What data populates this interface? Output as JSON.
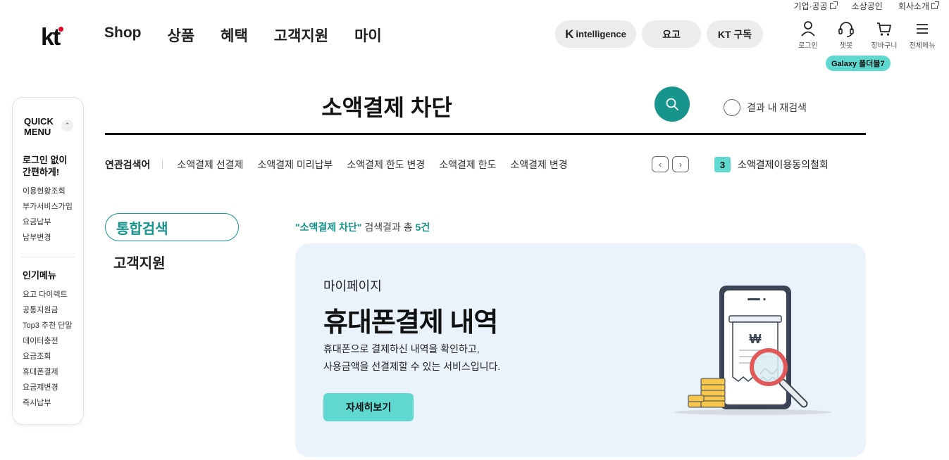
{
  "util_links": [
    "기업·공공",
    "소상공인",
    "회사소개"
  ],
  "logo": "kt",
  "gnb": [
    "Shop",
    "상품",
    "혜택",
    "고객지원",
    "마이"
  ],
  "pills": {
    "intelligence": "intelligence",
    "yogo": "요고",
    "subscribe": "KT 구독"
  },
  "header_icons": [
    {
      "label": "로그인",
      "icon": "person-icon"
    },
    {
      "label": "챗봇",
      "icon": "headset-icon"
    },
    {
      "label": "장바구니",
      "icon": "cart-icon"
    },
    {
      "label": "전체메뉴",
      "icon": "hamburger-icon"
    }
  ],
  "galaxy_badge": "Galaxy 폴더블7",
  "quick_menu": {
    "title_1": "QUICK",
    "title_2": "MENU",
    "section1_title_1": "로그인 없이",
    "section1_title_2": "간편하게!",
    "section1_items": [
      "이용현황조회",
      "부가서비스가입",
      "요금납부",
      "납부변경"
    ],
    "section2_title": "인기메뉴",
    "section2_items": [
      "요고 다이렉트",
      "공통지원금",
      "Top3 추천 단말",
      "데이터충전",
      "요금조회",
      "휴대폰결제",
      "요금제변경",
      "즉시납부"
    ]
  },
  "search": {
    "query": "소액결제 차단",
    "research_label": "결과 내 재검색"
  },
  "related": {
    "label": "연관검색어",
    "keywords": [
      "소액결제 선결제",
      "소액결제 미리납부",
      "소액결제 한도 변경",
      "소액결제 한도",
      "소액결제 변경"
    ],
    "rank_number": "3",
    "rank_keyword": "소액결제이용동의철회"
  },
  "tabs": {
    "all": "통합검색",
    "cs": "고객지원"
  },
  "summary": {
    "query_quoted": "\"소액결제 차단\"",
    "text": " 검색결과 총 ",
    "count": "5건"
  },
  "result_card": {
    "category": "마이페이지",
    "title": "휴대폰결제 내역",
    "desc_1": "휴대폰으로 결제하신 내역을 확인하고,",
    "desc_2": "사용금액을 선결제할 수 있는 서비스입니다.",
    "button": "자세히보기"
  },
  "colors": {
    "accent": "#17958d",
    "mint": "#5fd8d0",
    "card_bg": "#eaf3fb"
  }
}
